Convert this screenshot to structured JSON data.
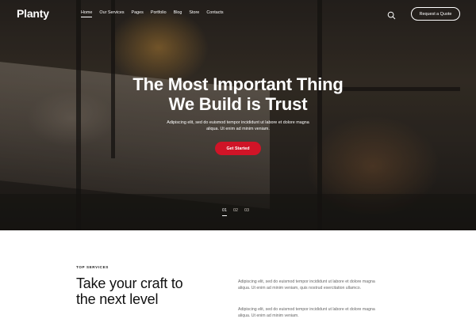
{
  "header": {
    "logo": "Planty",
    "nav": [
      {
        "label": "Home",
        "active": true
      },
      {
        "label": "Our Services",
        "active": false
      },
      {
        "label": "Pages",
        "active": false
      },
      {
        "label": "Portfolio",
        "active": false
      },
      {
        "label": "Blog",
        "active": false
      },
      {
        "label": "Store",
        "active": false
      },
      {
        "label": "Contacts",
        "active": false
      }
    ],
    "search_icon": "search-icon",
    "quote_button": "Request a Quote"
  },
  "hero": {
    "title_line1": "The Most Important Thing",
    "title_line2": "We Build is Trust",
    "subtitle": "Adipiscing elit, sed do euismod tempor incididunt ut labore et dolore magna aliqua. Ut enim ad minim veniam.",
    "cta": "Get Started",
    "slides": [
      "01",
      "02",
      "03"
    ],
    "active_slide": "01"
  },
  "services": {
    "eyebrow": "TOP SERVICES",
    "title_line1": "Take your craft to",
    "title_line2": "the next level",
    "paragraph1": "Adipiscing elit, sed do euismod tempor incididunt ut labore et dolore magna aliqua. Ut enim ad minim veniam, quis nostrud exercitation ullamco.",
    "paragraph2": "Adipiscing elit, sed do euismod tempor incididunt ut labore et dolore magna aliqua. Ut enim ad minim veniam."
  },
  "colors": {
    "accent": "#d01427",
    "nav_text": "#ffffff"
  }
}
